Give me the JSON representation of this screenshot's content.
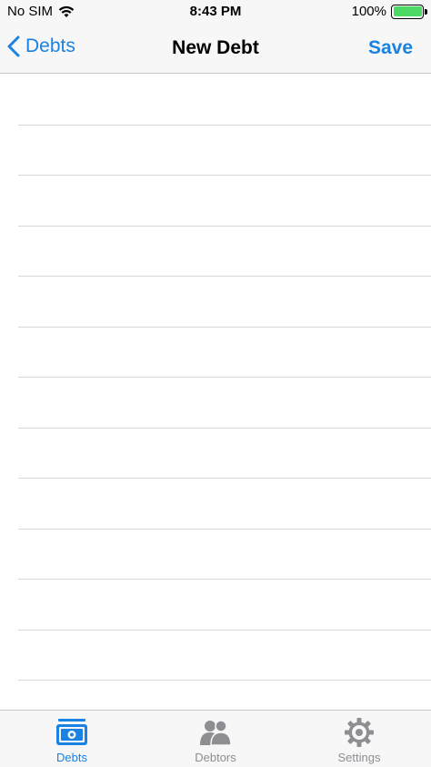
{
  "status_bar": {
    "carrier": "No SIM",
    "time": "8:43 PM",
    "battery": "100%"
  },
  "nav": {
    "back_label": "Debts",
    "title": "New Debt",
    "save_label": "Save"
  },
  "table": {
    "rows": [
      "",
      "",
      "",
      "",
      "",
      "",
      "",
      "",
      "",
      "",
      "",
      "",
      ""
    ]
  },
  "tabs": [
    {
      "label": "Debts",
      "icon": "money-icon",
      "active": true
    },
    {
      "label": "Debtors",
      "icon": "people-icon",
      "active": false
    },
    {
      "label": "Settings",
      "icon": "gear-icon",
      "active": false
    }
  ],
  "colors": {
    "accent": "#1a82e2",
    "inactive": "#8e8e93",
    "battery": "#4cd964"
  }
}
